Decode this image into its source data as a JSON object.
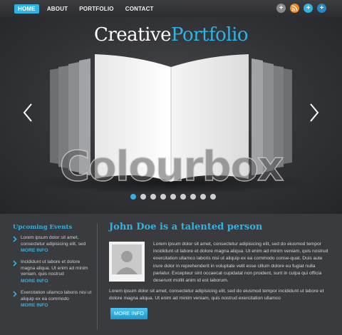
{
  "nav": {
    "items": [
      {
        "label": "HOME",
        "active": true
      },
      {
        "label": "ABOUT",
        "active": false
      },
      {
        "label": "PORTFOLIO",
        "active": false
      },
      {
        "label": "CONTACT",
        "active": false
      }
    ],
    "social": [
      {
        "icon": "plus-icon",
        "glyph": "+",
        "color": "#8a8a8a"
      },
      {
        "icon": "rss-icon",
        "glyph": "◢",
        "color": "#f08a24"
      },
      {
        "icon": "plus-icon",
        "glyph": "+",
        "color": "#2fb2e4"
      },
      {
        "icon": "plus-icon",
        "glyph": "+",
        "color": "#2b86c6"
      }
    ]
  },
  "hero": {
    "title_part1": "Creative",
    "title_part2": "Portfolio",
    "watermark": "Colourbox",
    "slide_count": 9,
    "active_slide": 0
  },
  "events": {
    "title": "Upcoming Events",
    "items": [
      {
        "text": "Lorem ipsum dolor sit amet, consectetur adipisicing elit, sed",
        "more": "MORE INFO"
      },
      {
        "text": "Incididunt ut labore et dolore magna aliqua. Ut enim ad minim veniam, quis nostrud",
        "more": "MORE INFO"
      },
      {
        "text": "Exercitation ullamco laboris nisi ut aliquip ex ea commodo",
        "more": "MORE INFO"
      }
    ]
  },
  "main": {
    "title": "John Doe is a talented person",
    "para1": "Lorem ipsum dolor sit amet, consectetur adipisicing elit, sed do eiusmod tempor incididunt ut labore et dolore magna aliqua. Ut enim ad minim veniam, quis nostrud exercitation ullamco laboris nisi ut aliquip ex ea commodo conse-quat. Duis aute irure dolor in reprehenderit in voluptate velit esse cillum dolore eu fugiat nulla pariatur. Excepteur sint occaecat cupidatat non proident, sunt in culpa qui officia deserunt mollit anim id est laborum.",
    "para2": "Lorem ipsum dolor sit amet, consectetur adipisicing elit, sed do eiusmod tempor incididunt ut labore et dolore magna aliqua. Ut enim ad minim veniam, quis nostrud exercitation ullamco",
    "button": "MORE INFO"
  },
  "colors": {
    "accent": "#2fb2e4",
    "background": "#2a2b2d"
  }
}
